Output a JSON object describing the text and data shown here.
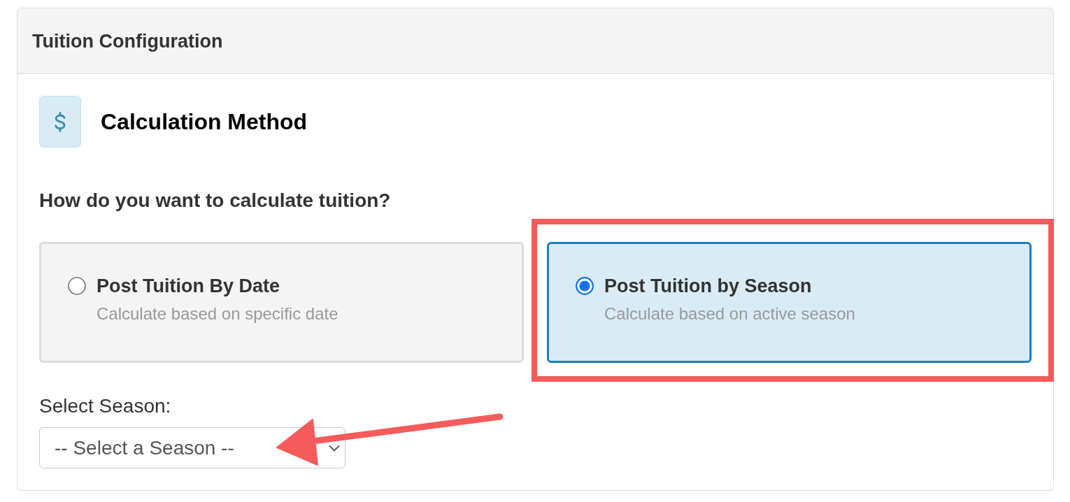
{
  "panel": {
    "title": "Tuition Configuration"
  },
  "section": {
    "heading": "Calculation Method"
  },
  "question": "How do you want to calculate tuition?",
  "options": [
    {
      "title": "Post Tuition By Date",
      "description": "Calculate based on specific date",
      "selected": false,
      "highlighted": false
    },
    {
      "title": "Post Tuition by Season",
      "description": "Calculate based on active season",
      "selected": true,
      "highlighted": true
    }
  ],
  "season_select": {
    "label": "Select Season:",
    "placeholder": "-- Select a Season --",
    "arrow": true
  }
}
